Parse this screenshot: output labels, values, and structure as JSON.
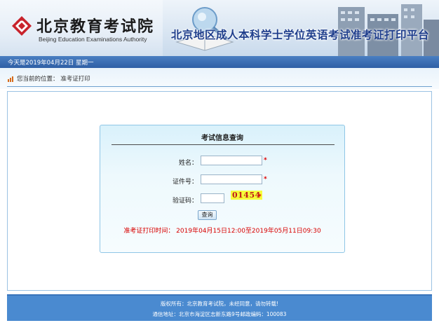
{
  "header": {
    "logo_cn": "北京教育考试院",
    "logo_en": "Beijing Education Examinations Authority",
    "title": "北京地区成人本科学士学位英语考试准考证打印平台"
  },
  "datebar": {
    "text": "今天是2019年04月22日 星期一"
  },
  "breadcrumb": {
    "text": "您当前的位置： 准考证打印"
  },
  "form": {
    "title": "考试信息查询",
    "name_label": "姓名：",
    "name_value": "",
    "id_label": "证件号：",
    "id_value": "",
    "captcha_label": "验证码：",
    "captcha_value": "",
    "captcha_code": "01454",
    "required_mark": "*",
    "submit_label": "查询",
    "print_time": "准考证打印时间： 2019年04月15日12:00至2019年05月11日09:30"
  },
  "footer": {
    "line1": "版权所有：北京教育考试院，未经同意，请勿转载!",
    "line2": "通信地址：北京市海淀区志新东路9号邮政编码：100083"
  },
  "colors": {
    "brand_blue": "#1f3e8c",
    "bar_blue": "#2f5fa5",
    "footer_blue": "#4a8ad0",
    "required_red": "#e00000",
    "captcha_bg": "#f6ff3a"
  }
}
